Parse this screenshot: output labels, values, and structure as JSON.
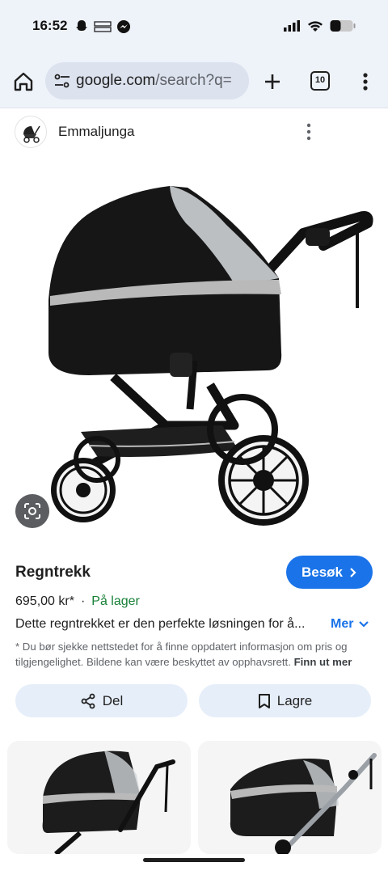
{
  "status_bar": {
    "time": "16:52",
    "left_icons": [
      "snapchat-icon",
      "temu-icon",
      "messenger-icon"
    ],
    "right_icons": [
      "signal-icon",
      "wifi-icon",
      "battery-icon"
    ]
  },
  "browser": {
    "url_host": "google.com",
    "url_path": "/search?q=",
    "tab_count": "10"
  },
  "source": {
    "name": "Emmaljunga"
  },
  "product": {
    "title": "Regntrekk",
    "visit_label": "Besøk",
    "price": "695,00 kr*",
    "separator": "·",
    "stock": "På lager",
    "description": "Dette regntrekket er den perfekte løsningen for å...",
    "more_label": "Mer",
    "disclaimer": "* Du bør sjekke nettstedet for å finne oppdatert informasjon om pris og tilgjengelighet. Bildene kan være beskyttet av opphavsrett.",
    "disclaimer_link": "Finn ut mer"
  },
  "actions": {
    "share_label": "Del",
    "save_label": "Lagre"
  },
  "colors": {
    "accent": "#1a73e8",
    "stock_green": "#188038",
    "chrome_bg": "#eef2f9",
    "action_bg": "#e6eef9"
  }
}
